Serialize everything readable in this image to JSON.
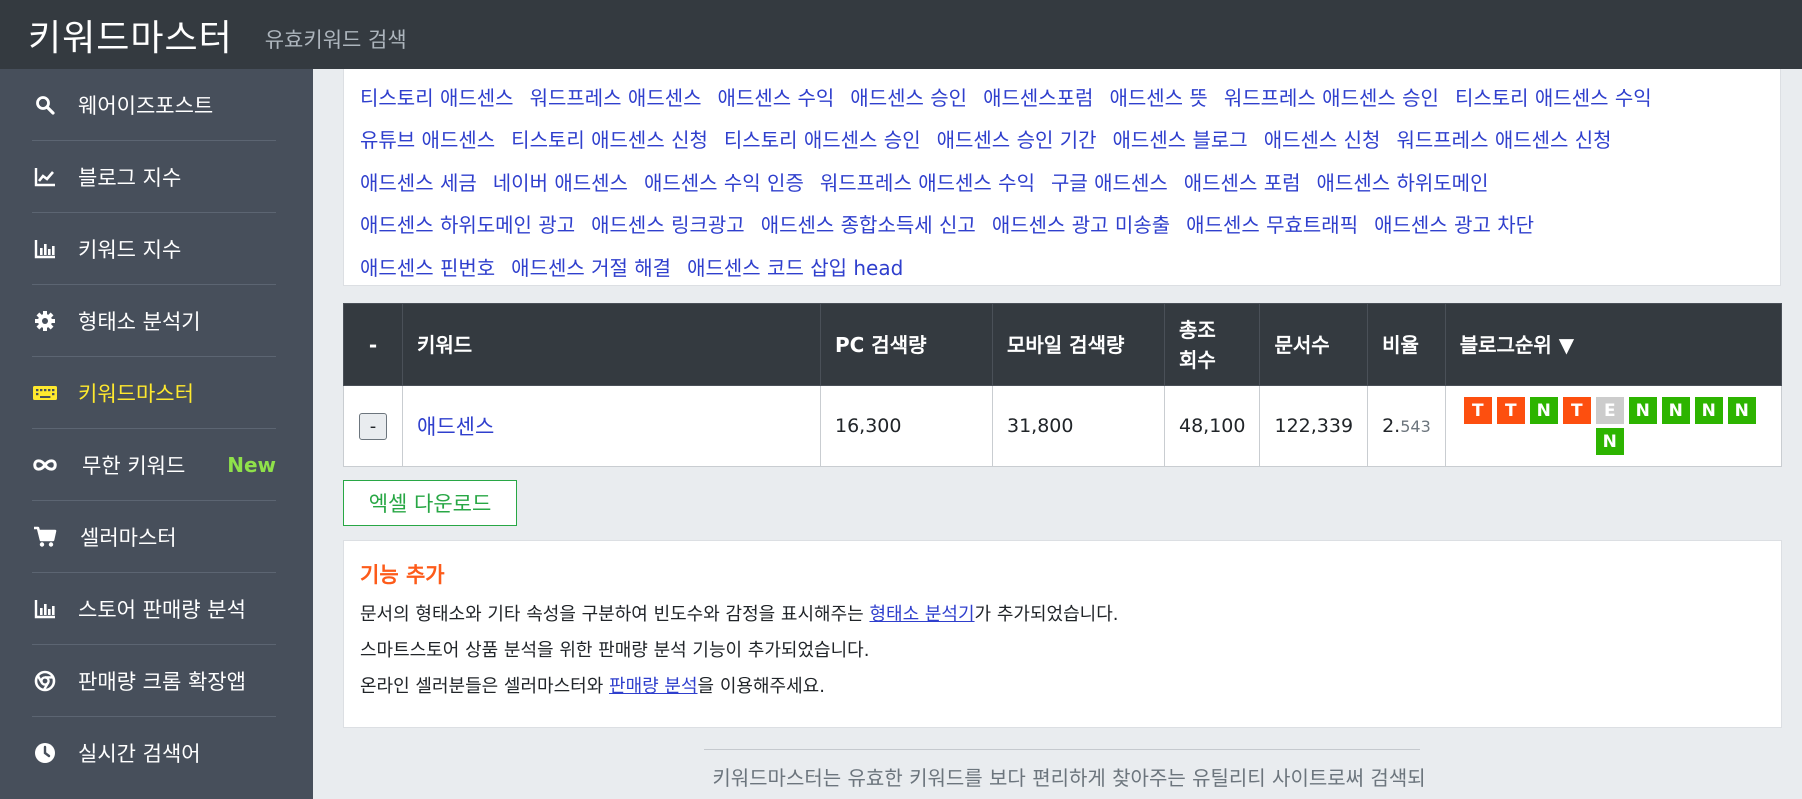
{
  "header": {
    "brand": "키워드마스터",
    "subtitle": "유효키워드 검색"
  },
  "sidebar": {
    "items": [
      {
        "label": "웨어이즈포스트",
        "icon": "search-icon"
      },
      {
        "label": "블로그 지수",
        "icon": "line-chart-icon"
      },
      {
        "label": "키워드 지수",
        "icon": "bar-chart-icon"
      },
      {
        "label": "형태소 분석기",
        "icon": "gear-icon"
      },
      {
        "label": "키워드마스터",
        "icon": "keyboard-icon",
        "active": true
      },
      {
        "label": "무한 키워드",
        "icon": "infinity-icon",
        "badge": "New"
      },
      {
        "label": "셀러마스터",
        "icon": "cart-icon"
      },
      {
        "label": "스토어 판매량 분석",
        "icon": "bar-chart-icon"
      },
      {
        "label": "판매량 크롬 확장앱",
        "icon": "chrome-icon"
      },
      {
        "label": "실시간 검색어",
        "icon": "clock-icon"
      }
    ]
  },
  "related_keywords": {
    "rows": [
      [
        "티스토리 애드센스",
        "워드프레스 애드센스",
        "애드센스 수익",
        "애드센스 승인",
        "애드센스포럼",
        "애드센스 뜻",
        "워드프레스 애드센스 승인",
        "티스토리 애드센스 수익"
      ],
      [
        "유튜브 애드센스",
        "티스토리 애드센스 신청",
        "티스토리 애드센스 승인",
        "애드센스 승인 기간",
        "애드센스 블로그",
        "애드센스 신청",
        "워드프레스 애드센스 신청"
      ],
      [
        "애드센스 세금",
        "네이버 애드센스",
        "애드센스 수익 인증",
        "워드프레스 애드센스 수익",
        "구글 애드센스",
        "애드센스 포럼",
        "애드센스 하위도메인"
      ],
      [
        "애드센스 하위도메인 광고",
        "애드센스 링크광고",
        "애드센스 종합소득세 신고",
        "애드센스 광고 미송출",
        "애드센스 무효트래픽",
        "애드센스 광고 차단"
      ],
      [
        "애드센스 핀번호",
        "애드센스 거절 해결",
        "애드센스 코드 삽입 head"
      ]
    ]
  },
  "table": {
    "headers": {
      "minus": "-",
      "keyword": "키워드",
      "pc": "PC 검색량",
      "mobile": "모바일 검색량",
      "total_line1": "총조",
      "total_line2": "회수",
      "docs": "문서수",
      "ratio": "비율",
      "rank": "블로그순위 ▼"
    },
    "row": {
      "button": "-",
      "keyword": "애드센스",
      "pc": "16,300",
      "mobile": "31,800",
      "total": "48,100",
      "docs": "122,339",
      "ratio_int": "2.",
      "ratio_dec": "543",
      "ranks": [
        {
          "letter": "T",
          "color": "#fd4f0f"
        },
        {
          "letter": "T",
          "color": "#fd4f0f"
        },
        {
          "letter": "N",
          "color": "#2db400"
        },
        {
          "letter": "T",
          "color": "#fd4f0f"
        },
        {
          "letter": "E",
          "color": "#cccccc"
        },
        {
          "letter": "N",
          "color": "#2db400"
        },
        {
          "letter": "N",
          "color": "#2db400"
        },
        {
          "letter": "N",
          "color": "#2db400"
        },
        {
          "letter": "N",
          "color": "#2db400"
        },
        {
          "letter": "N",
          "color": "#2db400"
        }
      ]
    }
  },
  "excel_button": "엑셀 다운로드",
  "notice": {
    "title": "기능 추가",
    "line1_pre": "문서의 형태소와 기타 속성을 구분하여 빈도수와 감정을 표시해주는 ",
    "line1_link": "형태소 분석기",
    "line1_post": "가 추가되었습니다.",
    "line2": "스마트스토어 상품 분석을 위한 판매량 분석 기능이 추가되었습니다.",
    "line3_pre": "온라인 셀러분들은 셀러마스터와 ",
    "line3_link": "판매량 분석",
    "line3_post": "을 이용해주세요."
  },
  "footer": {
    "text": "키워드마스터는 유효한 키워드를 보다 편리하게 찾아주는 유틸리티 사이트로써 검색되는"
  }
}
